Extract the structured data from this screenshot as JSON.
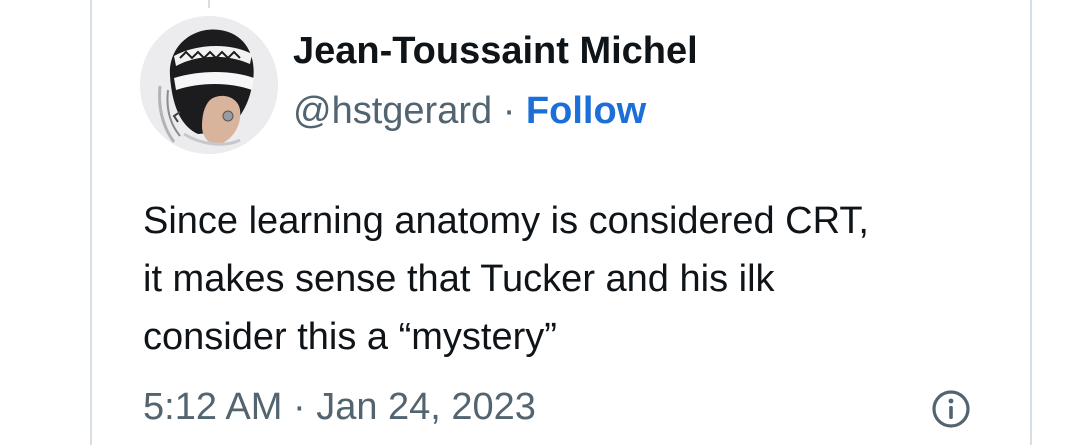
{
  "author": {
    "display_name": "Jean-Toussaint Michel",
    "handle": "@hstgerard",
    "separator": "·",
    "follow_label": "Follow",
    "avatar_icon": "profile-photo"
  },
  "tweet": {
    "lines": [
      "Since learning anatomy is considered CRT,",
      "it makes sense that Tucker and his ilk",
      "consider this a “mystery”"
    ]
  },
  "meta": {
    "timestamp": "5:12 AM · Jan 24, 2023",
    "info_icon": "info-circle-icon"
  },
  "colors": {
    "text": "#0f1419",
    "secondary": "#536471",
    "follow": "#1d6fd8",
    "border": "#d6dee6"
  }
}
